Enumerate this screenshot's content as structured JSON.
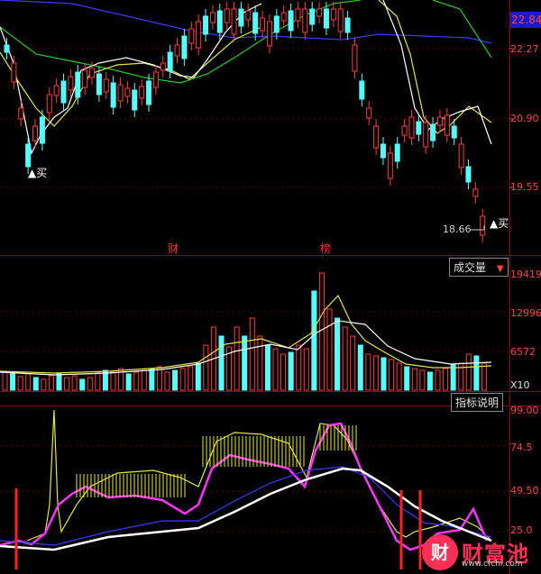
{
  "price_axis": {
    "current": "22.84",
    "ticks": [
      "22.27",
      "20.90",
      "19.55"
    ]
  },
  "signals": [
    {
      "text": "▲买"
    },
    {
      "text": "▲买"
    }
  ],
  "low_marker": "18.66",
  "events": [
    "财",
    "榜"
  ],
  "volume_panel": {
    "title_button": "成交量",
    "ticks": [
      "19419",
      "12996",
      "6572"
    ],
    "unit": "X10"
  },
  "indicator_panel": {
    "help_button": "指标说明",
    "ticks": [
      "99.00",
      "74.5",
      "49.50",
      "25.0"
    ]
  },
  "watermark": {
    "name": "财富池",
    "url": "www.cfchi.com"
  },
  "colors": {
    "up": "#ff3b3b",
    "down": "#54ffff",
    "grid": "#8b0000",
    "ma_white": "#ffffff",
    "ma_yellow": "#e6e640",
    "ma_green": "#22cc22",
    "ma_blue": "#3a3aff",
    "indicator_magenta": "#ff33ff"
  },
  "candles": [
    [
      12,
      -1,
      5,
      55
    ],
    [
      15,
      -1,
      30,
      190
    ],
    [
      18,
      -1,
      55,
      60
    ],
    [
      21,
      1,
      18,
      43
    ],
    [
      24,
      1,
      19,
      90
    ],
    [
      27,
      1,
      40,
      118
    ],
    [
      30,
      1,
      30,
      34
    ],
    [
      33,
      -1,
      36,
      36
    ],
    [
      36,
      1,
      20,
      140
    ],
    [
      39,
      1,
      20,
      80
    ],
    [
      42,
      -1,
      36,
      120
    ],
    [
      45,
      1,
      20,
      55
    ],
    [
      48,
      -1,
      45,
      38
    ],
    [
      51,
      1,
      24,
      33
    ],
    [
      54,
      1,
      24,
      110
    ],
    [
      57,
      1,
      20,
      110
    ],
    [
      60,
      1,
      20,
      92
    ],
    [
      63,
      1,
      20,
      100
    ],
    [
      66,
      1,
      22,
      108
    ],
    [
      69,
      -1,
      28,
      34
    ],
    [
      72,
      1,
      24,
      92
    ],
    [
      75,
      -1,
      30,
      72
    ],
    [
      78,
      1,
      40,
      120
    ],
    [
      81,
      1,
      35,
      150
    ],
    [
      84,
      1,
      38,
      54
    ],
    [
      87,
      1,
      30,
      58
    ],
    [
      90,
      1,
      34,
      30
    ],
    [
      93,
      -1,
      38,
      80
    ],
    [
      96,
      1,
      32,
      138
    ],
    [
      99,
      1,
      28,
      120
    ],
    [
      102,
      1,
      28,
      134
    ],
    [
      105,
      -1,
      36,
      44
    ],
    [
      108,
      1,
      24,
      60
    ],
    [
      111,
      -1,
      34,
      42
    ],
    [
      114,
      1,
      28,
      140
    ],
    [
      117,
      1,
      30,
      146
    ],
    [
      120,
      -1,
      28,
      80
    ],
    [
      123,
      1,
      30,
      92
    ],
    [
      126,
      1,
      38,
      60
    ],
    [
      129,
      -1,
      32,
      46
    ],
    [
      132,
      1,
      26,
      54
    ],
    [
      135,
      1,
      30,
      108
    ],
    [
      138,
      -1,
      28,
      58
    ],
    [
      141,
      1,
      32,
      72
    ],
    [
      144,
      -1,
      38,
      132
    ],
    [
      147,
      1,
      32,
      154
    ],
    [
      150,
      1,
      32,
      84
    ],
    [
      153,
      -1,
      36,
      68
    ],
    [
      156,
      1,
      40,
      110
    ],
    [
      159,
      -1,
      42,
      74
    ],
    [
      162,
      1,
      36,
      132
    ],
    [
      165,
      1,
      26,
      84
    ],
    [
      168,
      1,
      30,
      68
    ],
    [
      171,
      -1,
      32,
      46
    ],
    [
      174,
      1,
      34,
      72
    ],
    [
      177,
      1,
      34,
      72
    ],
    [
      180,
      1,
      30,
      66
    ],
    [
      183,
      -1,
      38,
      46
    ],
    [
      186,
      1,
      32,
      60
    ],
    [
      189,
      -1,
      32,
      80
    ],
    [
      192,
      1,
      30,
      54
    ],
    [
      195,
      1,
      30,
      54
    ],
    [
      198,
      -1,
      34,
      40
    ],
    [
      201,
      1,
      34,
      36
    ],
    [
      204,
      -1,
      38,
      70
    ],
    [
      207,
      1,
      38,
      132
    ],
    [
      210,
      1,
      38,
      76
    ],
    [
      213,
      -1,
      44,
      64
    ],
    [
      216,
      1,
      42,
      66
    ],
    [
      219,
      1,
      36,
      78
    ],
    [
      222,
      1,
      38,
      134
    ],
    [
      225,
      1,
      40,
      102
    ],
    [
      228,
      -1,
      46,
      50
    ],
    [
      231,
      1,
      48,
      100
    ],
    [
      234,
      1,
      48,
      60
    ],
    [
      237,
      -1,
      54,
      62
    ],
    [
      240,
      1,
      44,
      40
    ],
    [
      243,
      1,
      46,
      50
    ],
    [
      246,
      1,
      46,
      54
    ],
    [
      249,
      -1,
      50,
      50
    ],
    [
      252,
      -1,
      56,
      40
    ],
    [
      255,
      1,
      56,
      56
    ]
  ]
}
